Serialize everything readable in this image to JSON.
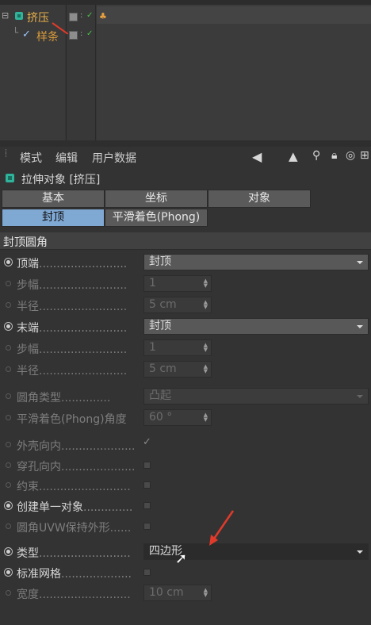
{
  "object_manager": {
    "objects": [
      {
        "name": "挤压",
        "indent": 0
      },
      {
        "name": "样条",
        "indent": 1
      }
    ]
  },
  "attribute_manager": {
    "menu": [
      "模式",
      "编辑",
      "用户数据"
    ],
    "title": "拉伸对象 [挤压]",
    "tabs_row1": [
      "基本",
      "坐标",
      "对象"
    ],
    "tabs_row2": [
      "封顶",
      "平滑着色(Phong)"
    ],
    "active_tab": "封顶",
    "section_title": "封顶圆角",
    "properties": [
      {
        "label": "顶端",
        "value": "封顶",
        "type": "dropdown",
        "enabled": true
      },
      {
        "label": "步幅",
        "value": "1",
        "type": "number",
        "enabled": false
      },
      {
        "label": "半径",
        "value": "5 cm",
        "type": "number",
        "enabled": false
      },
      {
        "label": "末端",
        "value": "封顶",
        "type": "dropdown",
        "enabled": true
      },
      {
        "label": "步幅",
        "value": "1",
        "type": "number",
        "enabled": false
      },
      {
        "label": "半径",
        "value": "5 cm",
        "type": "number",
        "enabled": false
      },
      {
        "label": "圆角类型",
        "value": "凸起",
        "type": "dropdown",
        "enabled": false
      },
      {
        "label": "平滑着色(Phong)角度",
        "value": "60 °",
        "type": "number",
        "enabled": false
      },
      {
        "label": "外壳向内",
        "value": "✓",
        "type": "checkbox",
        "enabled": false
      },
      {
        "label": "穿孔向内",
        "value": "",
        "type": "checkbox",
        "enabled": false
      },
      {
        "label": "约束",
        "value": "",
        "type": "checkbox",
        "enabled": false
      },
      {
        "label": "创建单一对象",
        "value": "",
        "type": "checkbox",
        "enabled": true
      },
      {
        "label": "圆角UVW保持外形",
        "value": "",
        "type": "checkbox",
        "enabled": false
      },
      {
        "label": "类型",
        "value": "四边形",
        "type": "dropdown",
        "enabled": true
      },
      {
        "label": "标准网格",
        "value": "",
        "type": "checkbox",
        "enabled": true
      },
      {
        "label": "宽度",
        "value": "10 cm",
        "type": "number",
        "enabled": false
      }
    ]
  },
  "colors": {
    "active_tab": "#7fa8d3",
    "object_name": "#e8b04a",
    "annotation_red": "#e03a2a",
    "panel_bg": "#333333"
  }
}
